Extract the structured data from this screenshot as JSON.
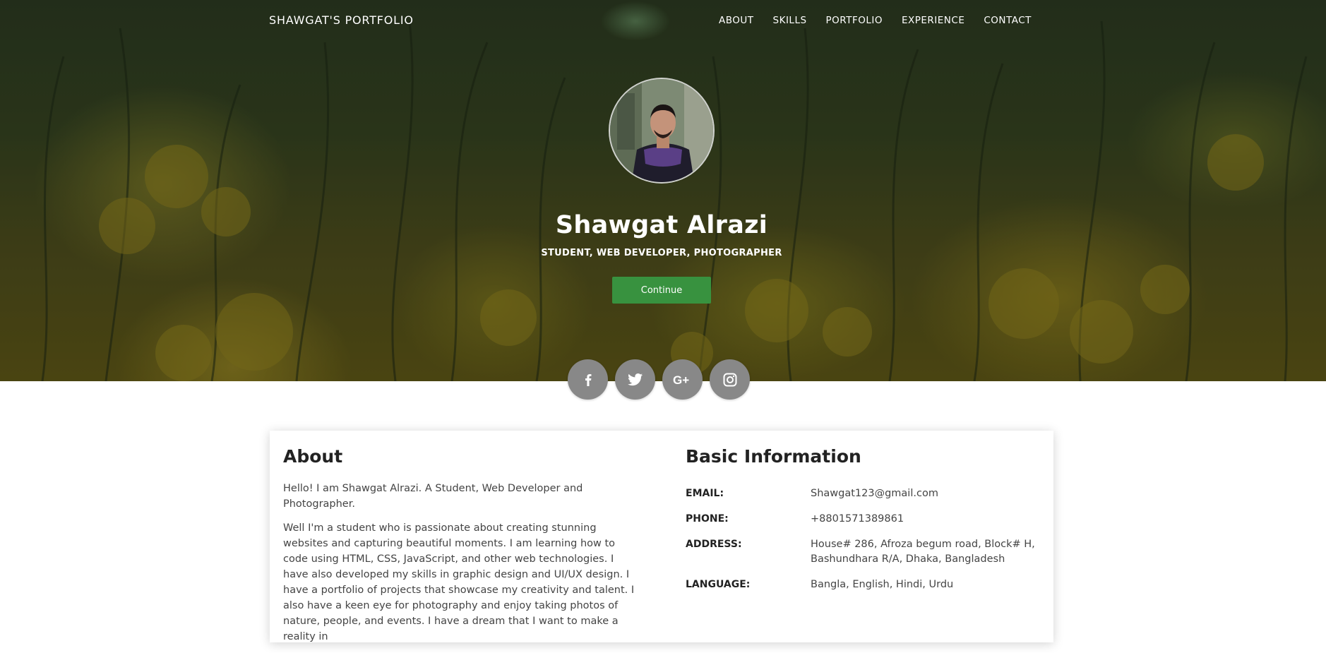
{
  "nav": {
    "brand": "SHAWGAT'S PORTFOLIO",
    "items": [
      {
        "label": "ABOUT"
      },
      {
        "label": "SKILLS"
      },
      {
        "label": "PORTFOLIO"
      },
      {
        "label": "EXPERIENCE"
      },
      {
        "label": "CONTACT"
      }
    ]
  },
  "hero": {
    "name": "Shawgat Alrazi",
    "subtitle": "STUDENT, WEB DEVELOPER, PHOTOGRAPHER",
    "button": "Continue"
  },
  "social": [
    "facebook-icon",
    "twitter-icon",
    "google-plus-icon",
    "instagram-icon"
  ],
  "about": {
    "title": "About",
    "p1": "Hello! I am Shawgat Alrazi. A Student, Web Developer and Photographer.",
    "p2": "Well I'm a student who is passionate about creating stunning websites and capturing beautiful moments. I am learning how to code using HTML, CSS, JavaScript, and other web technologies. I have also developed my skills in graphic design and UI/UX design. I have a portfolio of projects that showcase my creativity and talent. I also have a keen eye for photography and enjoy taking photos of nature, people, and events. I have a dream that I want to make a reality in"
  },
  "basic": {
    "title": "Basic Information",
    "rows": [
      {
        "label": "EMAIL:",
        "value": "Shawgat123@gmail.com"
      },
      {
        "label": "PHONE:",
        "value": "+8801571389861"
      },
      {
        "label": "ADDRESS:",
        "value": "House# 286, Afroza begum road, Block# H, Bashundhara R/A, Dhaka, Bangladesh"
      },
      {
        "label": "LANGUAGE:",
        "value": "Bangla, English, Hindi, Urdu"
      }
    ]
  },
  "colors": {
    "accent": "#38923f",
    "social_bg": "#888888"
  }
}
